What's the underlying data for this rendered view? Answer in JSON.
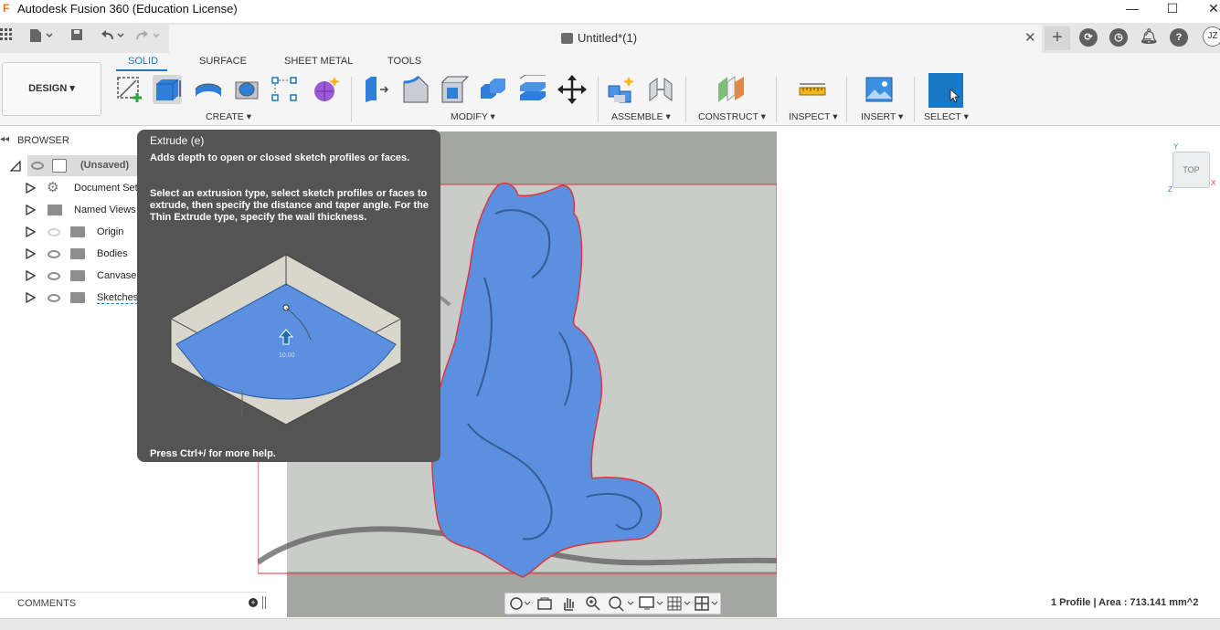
{
  "window": {
    "title": "Autodesk Fusion 360 (Education License)",
    "icon_letter": "F",
    "minimize": "—",
    "maximize": "☐",
    "close": "✕"
  },
  "tabs": {
    "document_title": "Untitled*(1)",
    "close_glyph": "✕",
    "new_tab_glyph": "+",
    "avatar_initials": "JZ"
  },
  "ribbon": {
    "workspace_label": "DESIGN ▾",
    "tabs": [
      "SOLID",
      "SURFACE",
      "SHEET METAL",
      "TOOLS"
    ],
    "groups": {
      "create": "CREATE ▾",
      "modify": "MODIFY ▾",
      "assemble": "ASSEMBLE ▾",
      "construct": "CONSTRUCT ▾",
      "inspect": "INSPECT ▾",
      "insert": "INSERT ▾",
      "select": "SELECT ▾"
    }
  },
  "browser": {
    "header": "BROWSER",
    "root": "(Unsaved)",
    "items": [
      {
        "label": "Document Sett",
        "icon": "gear-icon"
      },
      {
        "label": "Named Views",
        "icon": "folder-icon"
      },
      {
        "label": "Origin",
        "icon": "folder-icon"
      },
      {
        "label": "Bodies",
        "icon": "folder-icon"
      },
      {
        "label": "Canvase",
        "icon": "folder-icon"
      },
      {
        "label": "Sketches",
        "icon": "folder-icon"
      }
    ]
  },
  "tooltip": {
    "title": "Extrude (e)",
    "summary": "Adds depth to open or closed sketch profiles or faces.",
    "details": "Select an extrusion type, select sketch profiles or faces to extrude, then specify the distance and taper angle. For the Thin Extrude type, specify the wall thickness.",
    "image_value": "10.00",
    "footer": "Press Ctrl+/ for more help."
  },
  "comments": {
    "label": "COMMENTS"
  },
  "viewcube": {
    "face_label": "TOP",
    "axis_x": "X",
    "axis_y": "Y",
    "axis_z": "Z"
  },
  "status": {
    "text": "1 Profile | Area : 713.141 mm^2"
  },
  "colors": {
    "accent": "#1a78c2",
    "profile_fill": "#5b8fe0",
    "sketch_line": "#e0343c",
    "tooltip_bg": "#545454"
  }
}
